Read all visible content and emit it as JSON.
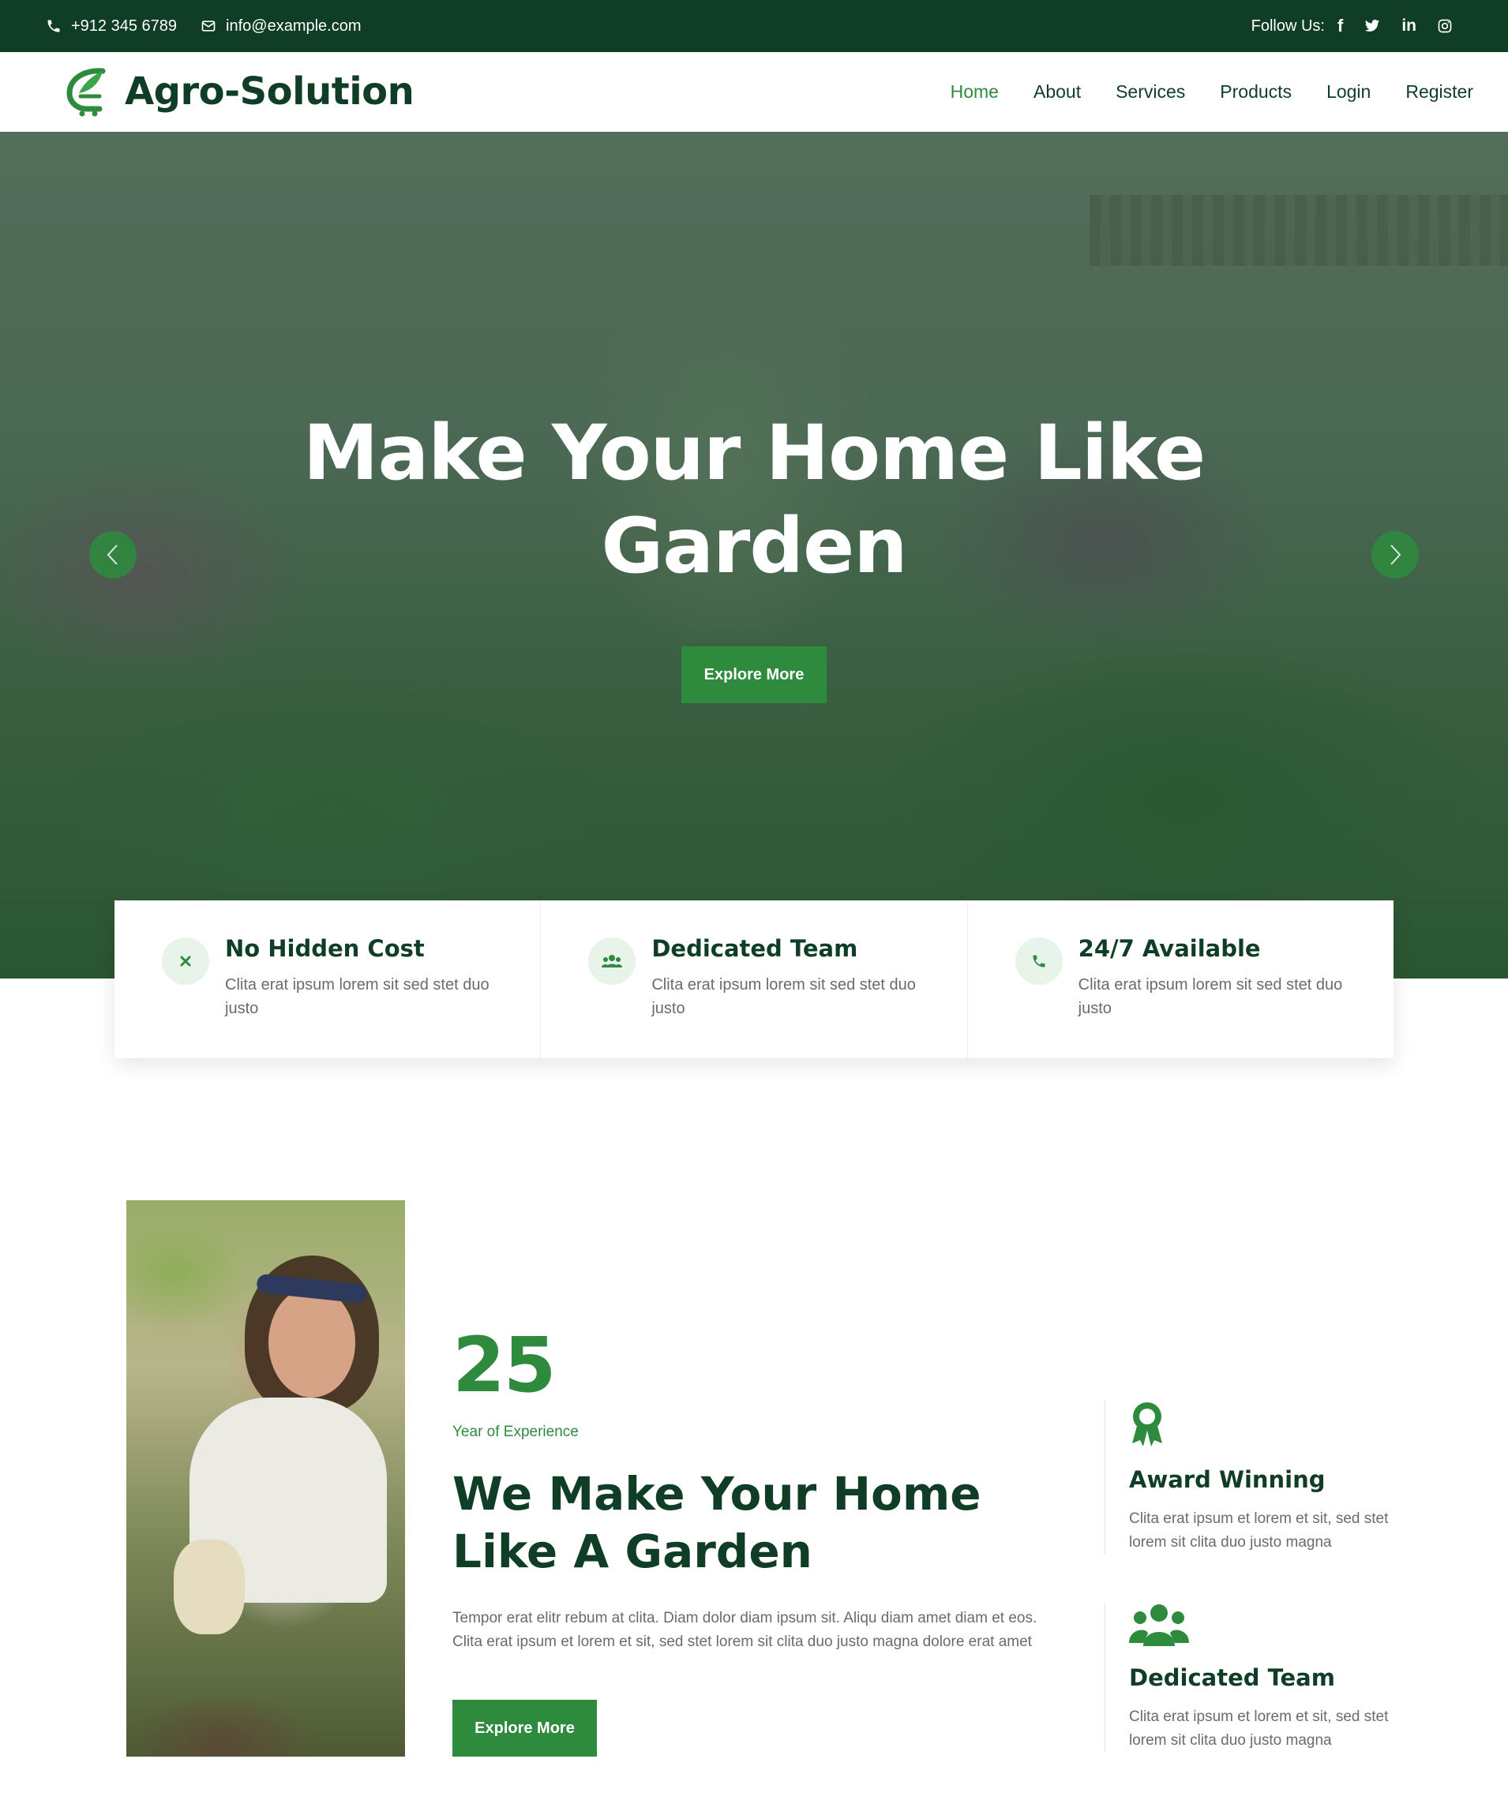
{
  "topbar": {
    "phone": "+912 345 6789",
    "email": "info@example.com",
    "follow_label": "Follow Us:",
    "social": [
      "facebook-icon",
      "twitter-icon",
      "linkedin-icon",
      "instagram-icon"
    ]
  },
  "brand": {
    "name": "Agro-Solution"
  },
  "nav": {
    "items": [
      {
        "label": "Home",
        "active": true
      },
      {
        "label": "About",
        "active": false
      },
      {
        "label": "Services",
        "active": false
      },
      {
        "label": "Products",
        "active": false
      },
      {
        "label": "Login",
        "active": false
      },
      {
        "label": "Register",
        "active": false
      }
    ]
  },
  "hero": {
    "title_line1": "Make Your Home Like",
    "title_line2": "Garden",
    "button": "Explore More"
  },
  "features": [
    {
      "icon": "x-icon",
      "title": "No Hidden Cost",
      "text": "Clita erat ipsum lorem sit sed stet duo justo"
    },
    {
      "icon": "users-icon",
      "title": "Dedicated Team",
      "text": "Clita erat ipsum lorem sit sed stet duo justo"
    },
    {
      "icon": "phone-icon",
      "title": "24/7 Available",
      "text": "Clita erat ipsum lorem sit sed stet duo justo"
    }
  ],
  "about": {
    "years": "25",
    "years_label": "Year of Experience",
    "title": "We Make Your Home Like A Garden",
    "text": "Tempor erat elitr rebum at clita. Diam dolor diam ipsum sit. Aliqu diam amet diam et eos. Clita erat ipsum et lorem et sit, sed stet lorem sit clita duo justo magna dolore erat amet",
    "button": "Explore More",
    "side": [
      {
        "icon": "award-icon",
        "title": "Award Winning",
        "text": "Clita erat ipsum et lorem et sit, sed stet lorem sit clita duo justo magna"
      },
      {
        "icon": "team-icon",
        "title": "Dedicated Team",
        "text": "Clita erat ipsum et lorem et sit, sed stet lorem sit clita duo justo magna"
      }
    ]
  },
  "colors": {
    "dark_green": "#0f3d26",
    "accent_green": "#2e8b3e",
    "light_green": "#e8f3ea"
  }
}
